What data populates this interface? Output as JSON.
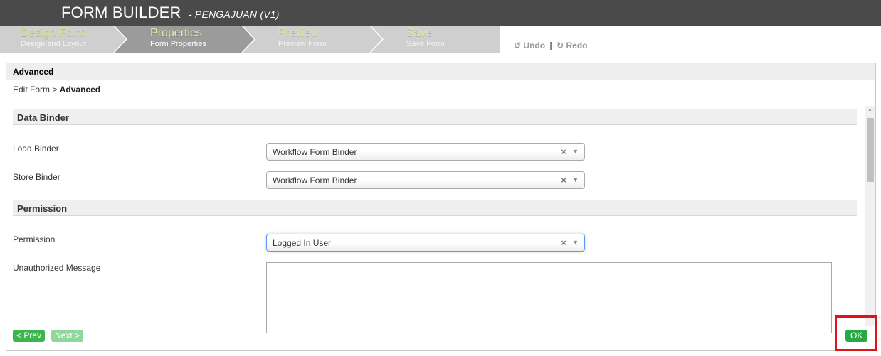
{
  "header": {
    "title": "FORM BUILDER",
    "subtitle": "- PENGAJUAN (V1)"
  },
  "steps": [
    {
      "name": "Design Form",
      "desc": "Design and Layout"
    },
    {
      "name": "Properties",
      "desc": "Form Properties"
    },
    {
      "name": "Preview",
      "desc": "Preview Form"
    },
    {
      "name": "Save",
      "desc": "Save Form"
    }
  ],
  "toolbar": {
    "undo_label": "Undo",
    "redo_label": "Redo",
    "separator": "|"
  },
  "panel": {
    "title": "Advanced",
    "breadcrumb_parent": "Edit Form",
    "breadcrumb_sep": ">",
    "breadcrumb_current": "Advanced"
  },
  "data_binder": {
    "section_title": "Data Binder",
    "load_binder_label": "Load Binder",
    "load_binder_value": "Workflow Form Binder",
    "store_binder_label": "Store Binder",
    "store_binder_value": "Workflow Form Binder"
  },
  "permission": {
    "section_title": "Permission",
    "permission_label": "Permission",
    "permission_value": "Logged In User",
    "unauthorized_label": "Unauthorized Message",
    "unauthorized_value": ""
  },
  "footer": {
    "prev_label": "< Prev",
    "next_label": "Next >",
    "ok_label": "OK"
  },
  "icons": {
    "clear": "×",
    "dropdown": "▼",
    "undo": "↺",
    "redo": "↻",
    "scroll_up": "▲"
  },
  "colors": {
    "header_bg": "#4a4a4a",
    "accent_green": "#2aa844",
    "highlight": "#e0121b"
  }
}
